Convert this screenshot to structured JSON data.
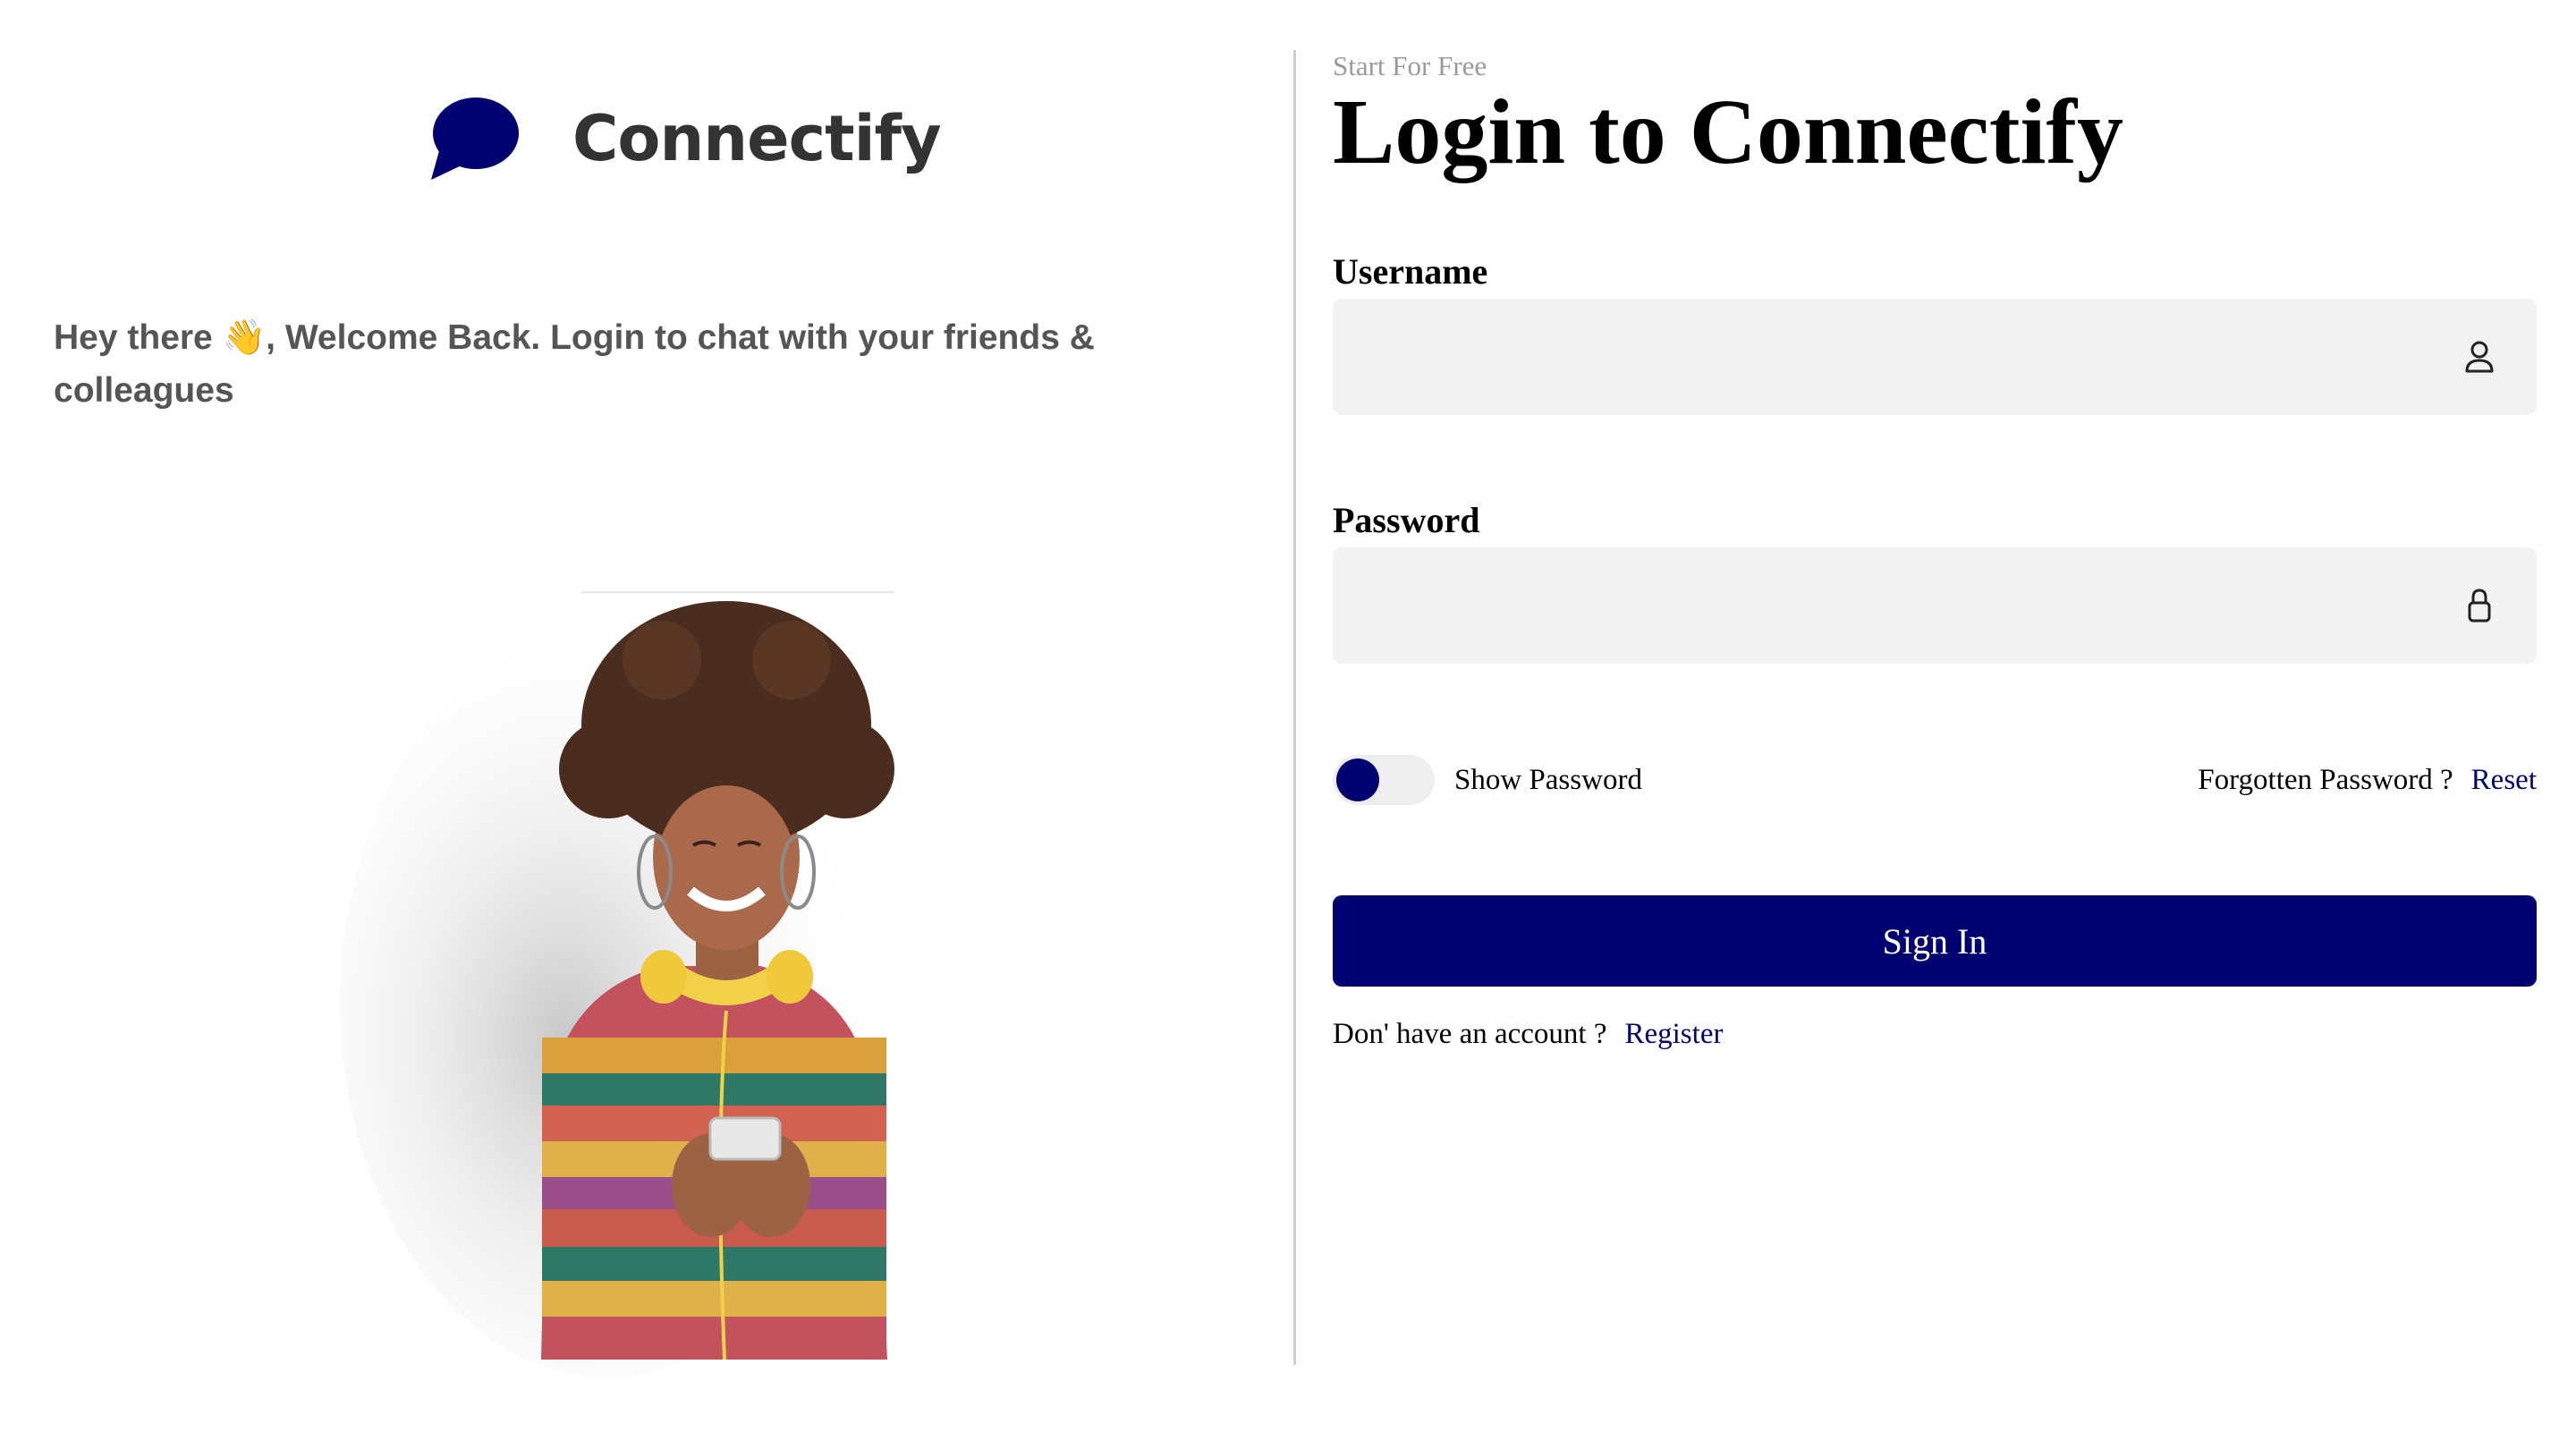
{
  "brand": {
    "name": "Connectify",
    "logo_icon": "chat-bubble-icon",
    "accent_color": "#000070"
  },
  "welcome_message": "Hey there 👋, Welcome Back. Login to chat with your friends & colleagues",
  "login": {
    "eyebrow": "Start For Free",
    "title": "Login to Connectify",
    "username": {
      "label": "Username",
      "value": "",
      "placeholder": "",
      "icon": "user-icon"
    },
    "password": {
      "label": "Password",
      "value": "",
      "placeholder": "",
      "icon": "lock-icon"
    },
    "show_password": {
      "label": "Show Password",
      "checked": false
    },
    "forgot": {
      "text": "Forgotten Password ?",
      "link": "Reset"
    },
    "submit_label": "Sign In",
    "register": {
      "text": "Don' have an account ?",
      "link": "Register"
    }
  }
}
